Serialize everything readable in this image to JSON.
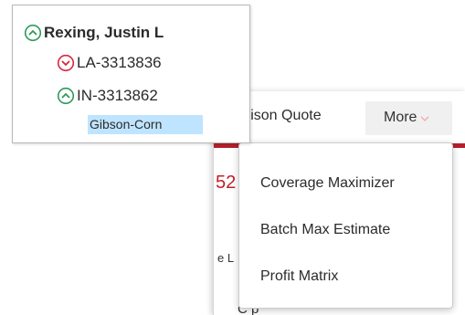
{
  "toolbar": {
    "comparison_quote_label": "arison Quote",
    "more_label": "More"
  },
  "background": {
    "red_fragment": "52",
    "l_fragment": "e L",
    "bottom_fragment": "C                                  p"
  },
  "more_menu": {
    "items": [
      {
        "label": "Coverage Maximizer"
      },
      {
        "label": "Batch Max Estimate"
      },
      {
        "label": "Profit Matrix"
      }
    ]
  },
  "tree": {
    "root": {
      "label": "Rexing, Justin L",
      "icon": "chevron-up-circle-icon",
      "color": "#2e9a5a"
    },
    "children": [
      {
        "label": "LA-3313836",
        "icon": "chevron-down-circle-icon",
        "color": "#d8283a"
      },
      {
        "label": "IN-3313862",
        "icon": "chevron-up-circle-icon",
        "color": "#2e9a5a"
      }
    ],
    "leaf": {
      "label": "Gibson-Corn"
    }
  },
  "colors": {
    "brand_red": "#b3202b",
    "selection": "#bfe4ff"
  }
}
